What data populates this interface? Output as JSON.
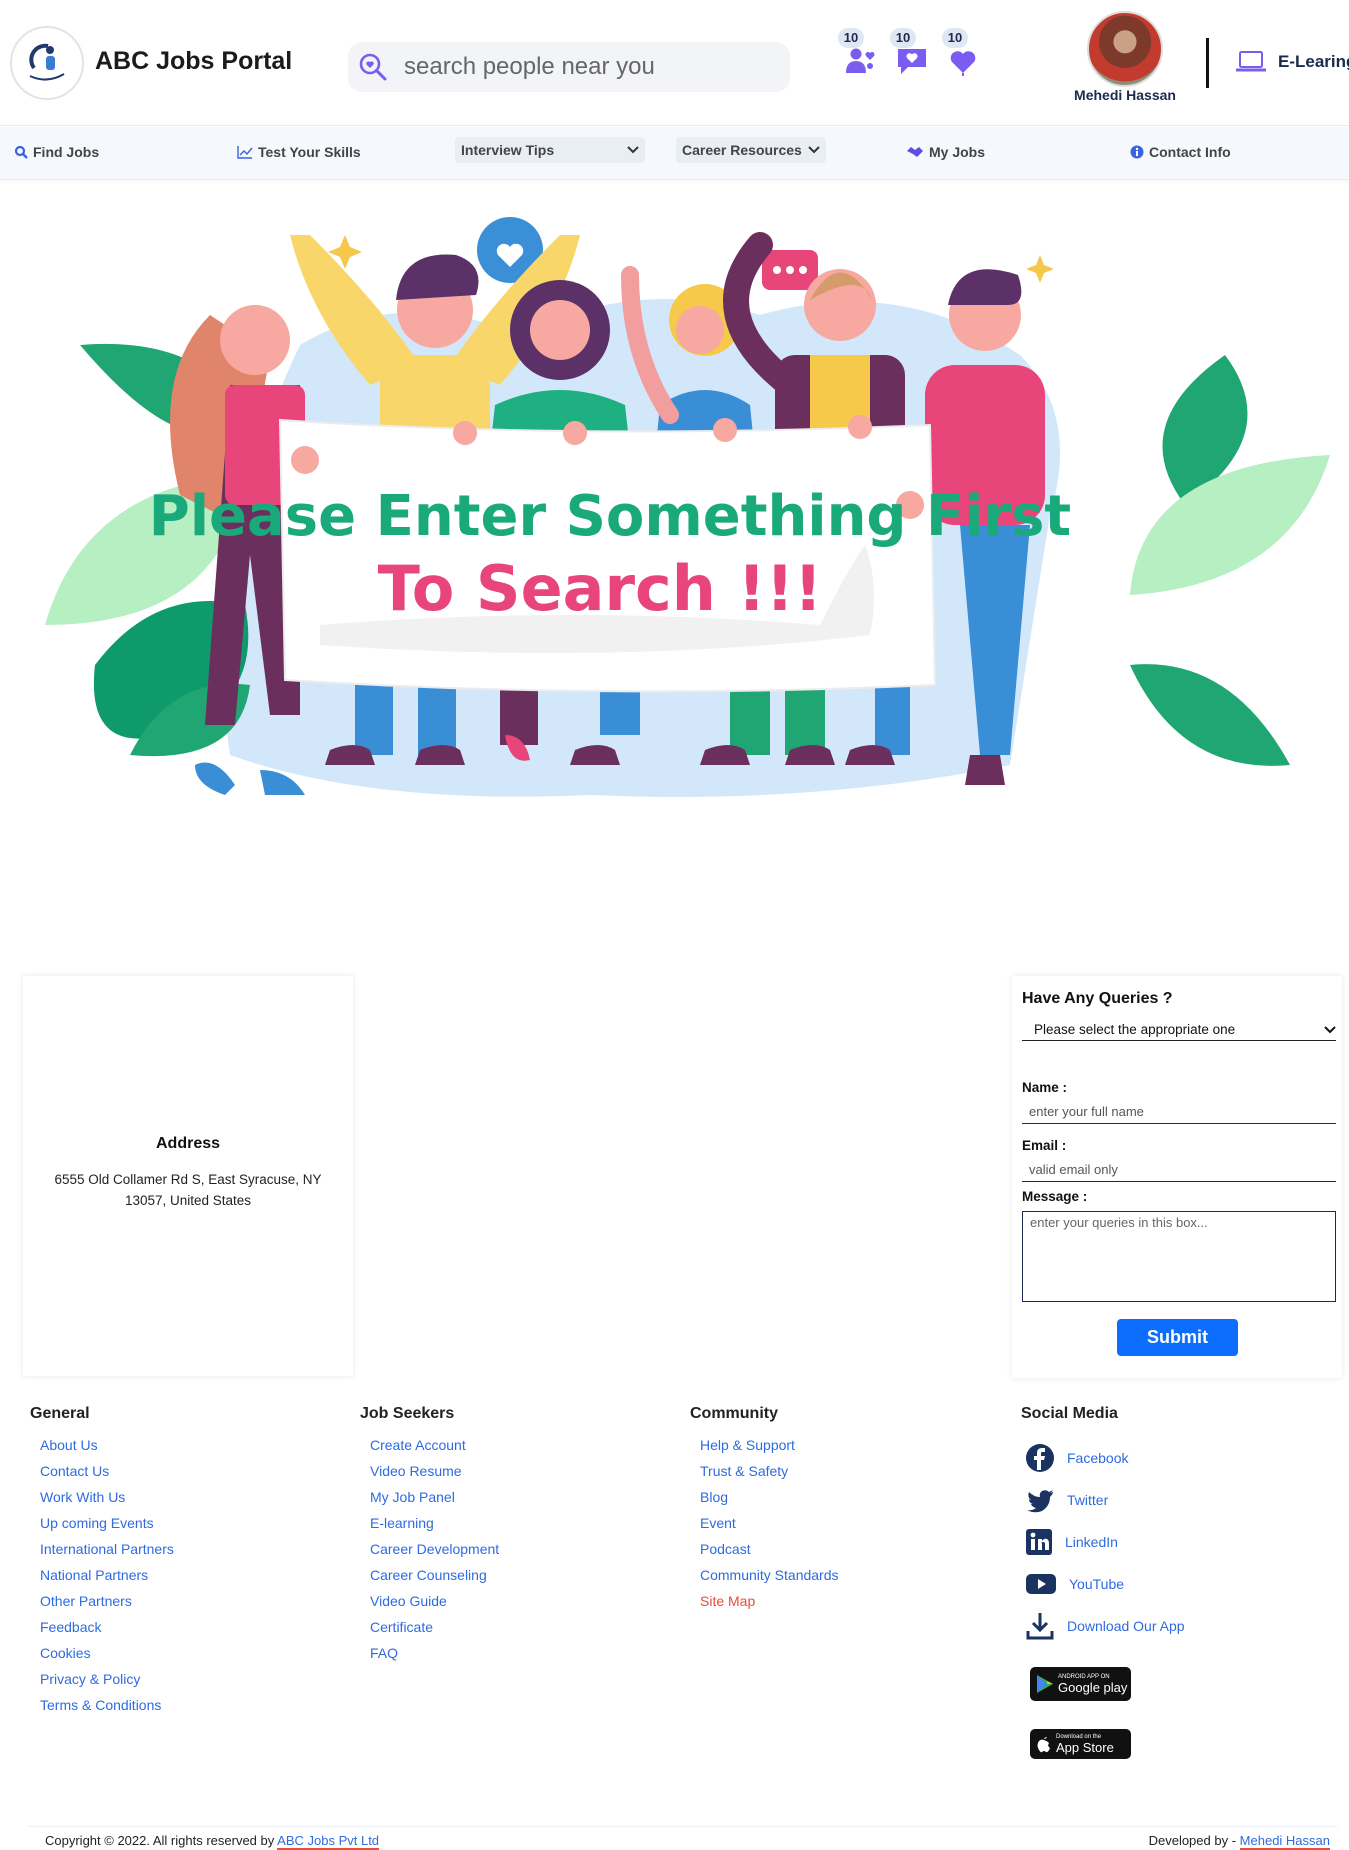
{
  "header": {
    "brand": "ABC Jobs Portal",
    "search_placeholder": "search people near you",
    "notifications": [
      {
        "name": "friend-requests",
        "count": "10"
      },
      {
        "name": "messages",
        "count": "10"
      },
      {
        "name": "likes",
        "count": "10"
      }
    ],
    "user_name": "Mehedi Hassan",
    "elearning_label": "E-Learing",
    "accent_color": "#7b5cf0"
  },
  "nav": {
    "find_jobs": "Find Jobs",
    "test_skills": "Test Your Skills",
    "interview_tips": "Interview Tips",
    "career_resources": "Career Resources",
    "my_jobs": "My Jobs",
    "contact_info": "Contact Info"
  },
  "hero": {
    "line1": "Please Enter Something First",
    "line2": "To Search !!!",
    "line1_color": "#19a97b",
    "line2_color": "#e8457a"
  },
  "address": {
    "title": "Address",
    "text": "6555 Old Collamer Rd S, East Syracuse, NY 13057, United States"
  },
  "query": {
    "title": "Have Any Queries ?",
    "select_value": "Please select the appropriate one",
    "name_label": "Name :",
    "name_placeholder": "enter your full name",
    "email_label": "Email :",
    "email_placeholder": "valid email only",
    "message_label": "Message :",
    "message_placeholder": "enter your queries in this box...",
    "submit": "Submit"
  },
  "footer": {
    "general": {
      "title": "General",
      "links": [
        "About Us",
        "Contact Us",
        "Work With Us",
        "Up coming Events",
        "International Partners",
        "National Partners",
        "Other Partners",
        "Feedback",
        "Cookies",
        "Privacy & Policy",
        "Terms & Conditions"
      ]
    },
    "job_seekers": {
      "title": "Job Seekers",
      "links": [
        "Create Account",
        "Video Resume",
        "My Job Panel",
        "E-learning",
        "Career Development",
        "Career Counseling",
        "Video Guide",
        "Certificate",
        "FAQ"
      ]
    },
    "community": {
      "title": "Community",
      "links": [
        "Help & Support",
        "Trust & Safety",
        "Blog",
        "Event",
        "Podcast",
        "Community Standards",
        "Site Map"
      ],
      "highlight_color": "#e74c3c"
    },
    "social": {
      "title": "Social Media",
      "links": [
        "Facebook",
        "Twitter",
        "LinkedIn",
        "YouTube",
        "Download Our App"
      ]
    },
    "google_play": {
      "small": "ANDROID APP ON",
      "big": "Google play"
    },
    "app_store": {
      "small": "Download on the",
      "big": "App Store"
    },
    "copyright": "Copyright © 2022. All rights reserved by",
    "company": "ABC Jobs Pvt Ltd",
    "developed_by": "Developed by -",
    "developer": "Mehedi Hassan"
  }
}
